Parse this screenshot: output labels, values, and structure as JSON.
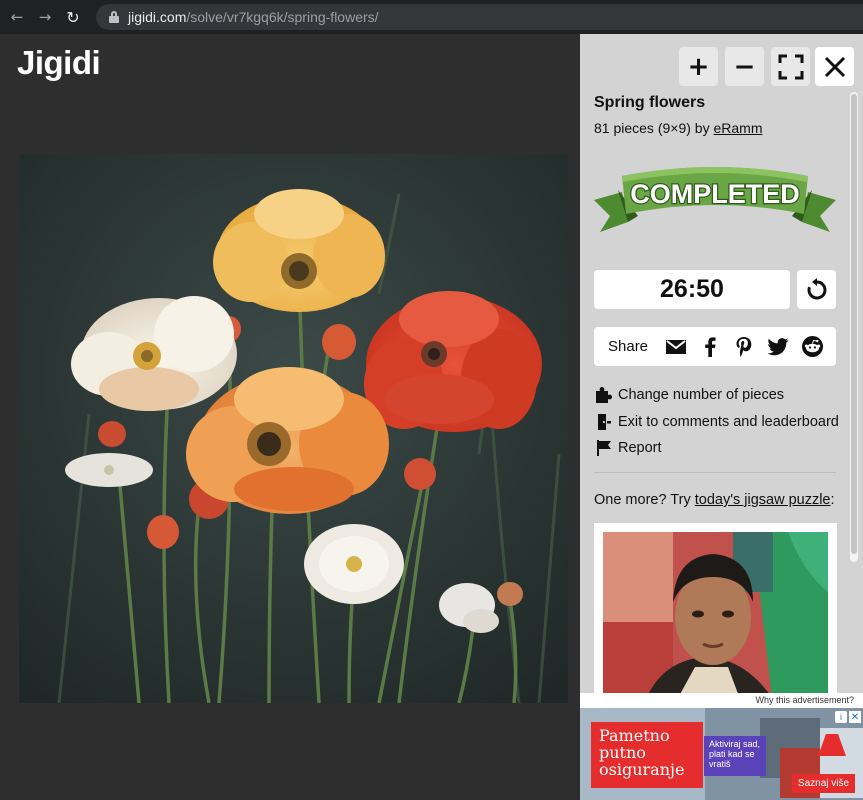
{
  "browser": {
    "url_host": "jigidi.com",
    "url_path": "/solve/vr7kgq6k/spring-flowers/"
  },
  "app": {
    "logo": "Jigidi"
  },
  "toolbar": {
    "zoom_in": "+",
    "zoom_out": "−"
  },
  "puzzle": {
    "title": "Spring flowers",
    "meta_prefix": "81 pieces (9×9) by ",
    "author": "eRamm",
    "status_banner": "COMPLETED",
    "timer": "26:50"
  },
  "share": {
    "label": "Share",
    "icons": [
      "email-icon",
      "facebook-icon",
      "pinterest-icon",
      "twitter-icon",
      "reddit-icon"
    ]
  },
  "menu": {
    "items": [
      {
        "icon": "puzzle-piece-icon",
        "label": "Change number of pieces"
      },
      {
        "icon": "exit-door-icon",
        "label": "Exit to comments and leaderboard"
      },
      {
        "icon": "flag-icon",
        "label": "Report"
      }
    ]
  },
  "promo": {
    "prefix": "One more? Try ",
    "link": "today's jigsaw puzzle",
    "suffix": ":"
  },
  "ad": {
    "why": "Why this advertisement?",
    "headline": "Pametno putno osiguranje",
    "sub": "Aktiviraj sad, plati kad se vratiš",
    "cta": "Saznaj više"
  },
  "colors": {
    "panel_bg": "#d3d3d3",
    "canvas_bg": "#2e2e2e",
    "banner_green": "#5f9a3c",
    "banner_dark": "#3f6f28",
    "ad_red": "#e62d2d"
  }
}
